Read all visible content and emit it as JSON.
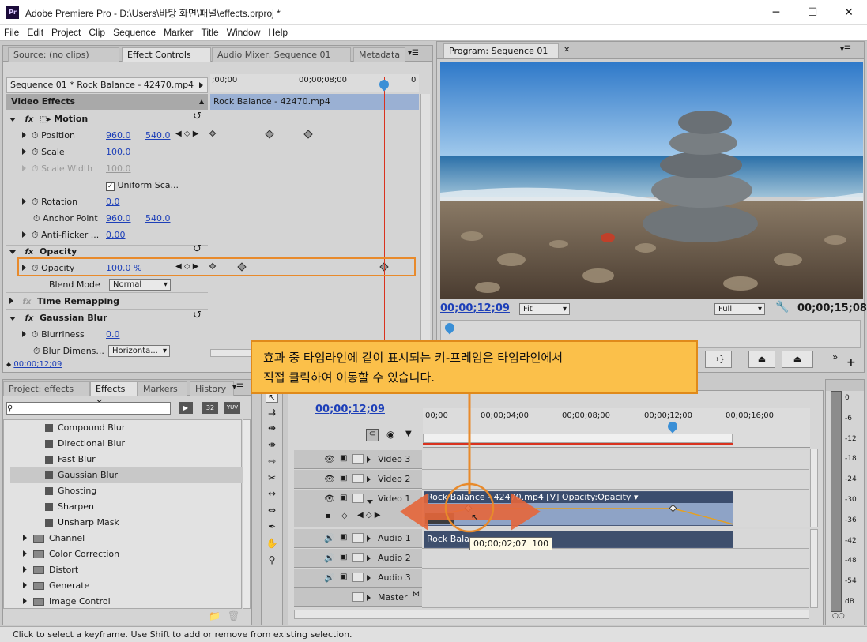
{
  "window": {
    "title": "Adobe Premiere Pro - D:\\Users\\바탕 화면\\패널\\effects.prproj *",
    "logo": "Pr"
  },
  "menu": [
    "File",
    "Edit",
    "Project",
    "Clip",
    "Sequence",
    "Marker",
    "Title",
    "Window",
    "Help"
  ],
  "source_tabs": {
    "source": "Source: (no clips)",
    "effect_controls": "Effect Controls",
    "audio_mixer": "Audio Mixer: Sequence 01",
    "metadata": "Metadata"
  },
  "effect_controls": {
    "sequence_clip": "Sequence 01 * Rock Balance - 42470.mp4",
    "ruler": {
      "start": ";00;00",
      "mid": "00;00;08;00",
      "end": "0"
    },
    "clip_bar": "Rock Balance - 42470.mp4",
    "section": "Video Effects",
    "motion": "Motion",
    "position": {
      "label": "Position",
      "x": "960.0",
      "y": "540.0"
    },
    "scale": {
      "label": "Scale",
      "value": "100.0"
    },
    "scale_width": {
      "label": "Scale Width",
      "value": "100.0"
    },
    "uniform_scale": "Uniform Sca...",
    "rotation": {
      "label": "Rotation",
      "value": "0.0"
    },
    "anchor_point": {
      "label": "Anchor Point",
      "x": "960.0",
      "y": "540.0"
    },
    "anti_flicker": {
      "label": "Anti-flicker ...",
      "value": "0.00"
    },
    "opacity_group": "Opacity",
    "opacity": {
      "label": "Opacity",
      "value": "100.0",
      "unit": "%"
    },
    "blend_mode": {
      "label": "Blend Mode",
      "value": "Normal"
    },
    "time_remapping": "Time Remapping",
    "gaussian_blur": "Gaussian Blur",
    "blurriness": {
      "label": "Blurriness",
      "value": "0.0"
    },
    "blur_dimensions": {
      "label": "Blur Dimens...",
      "value": "Horizonta..."
    },
    "timecode": "00;00;12;09"
  },
  "program": {
    "tab": "Program: Sequence 01",
    "timecode": "00;00;12;09",
    "fit": "Fit",
    "quality": "Full",
    "duration": "00;00;15;08"
  },
  "callout": {
    "line1": "효과 중 타임라인에 같이 표시되는 키-프레임은 타임라인에서",
    "line2": "직접 클릭하여 이동할 수 있습니다."
  },
  "project_tabs": {
    "project": "Project: effects",
    "effects": "Effects",
    "markers": "Markers",
    "history": "History"
  },
  "effects_list": {
    "badges": [
      "32",
      "YUV"
    ],
    "blur_items": [
      "Compound Blur",
      "Directional Blur",
      "Fast Blur",
      "Gaussian Blur",
      "Ghosting",
      "Sharpen",
      "Unsharp Mask"
    ],
    "folders": [
      "Channel",
      "Color Correction",
      "Distort",
      "Generate",
      "Image Control"
    ]
  },
  "timeline": {
    "timecode": "00;00;12;09",
    "ruler": [
      "00;00",
      "00;00;04;00",
      "00;00;08;00",
      "00;00;12;00",
      "00;00;16;00"
    ],
    "tracks": {
      "v3": "Video 3",
      "v2": "Video 2",
      "v1": "Video 1",
      "a1": "Audio 1",
      "a2": "Audio 2",
      "a3": "Audio 3",
      "master": "Master"
    },
    "video_clip": "Rock Balance - 42470.mp4 [V]",
    "opacity_menu": "Opacity:Opacity",
    "audio_clip": "Rock Balance",
    "tooltip": "00;00;02;07  100"
  },
  "meter": {
    "scale": [
      "0",
      "-6",
      "-12",
      "-18",
      "-24",
      "-30",
      "-36",
      "-42",
      "-48",
      "-54",
      "dB"
    ]
  },
  "status": "Click to select a keyframe. Use Shift to add or remove from existing selection.",
  "colors": {
    "accent": "#1d3fb8",
    "callout_bg": "#fbc04a",
    "callout_border": "#e08a1a",
    "playhead": "#d9321f",
    "highlight": "#e88a2b",
    "arrow": "#e5663a"
  }
}
